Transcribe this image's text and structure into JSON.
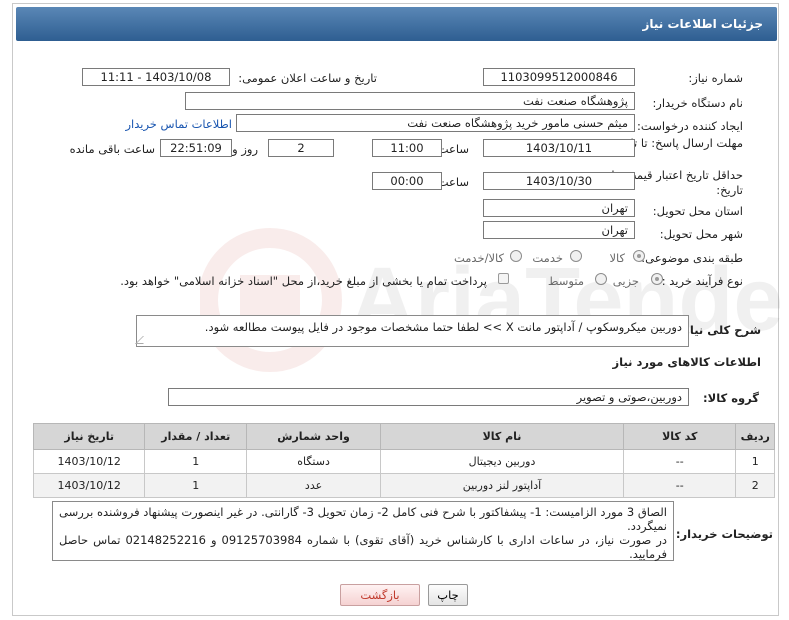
{
  "title": "جزئیات اطلاعات نیاز",
  "fields": {
    "need_number_label": "شماره نیاز:",
    "need_number": "1103099512000846",
    "announce_label": "تاریخ و ساعت اعلان عمومی:",
    "announce_value": "1403/10/08 - 11:11",
    "buyer_label": "نام دستگاه خریدار:",
    "buyer_value": "پژوهشگاه صنعت نفت",
    "creator_label": "ایجاد کننده درخواست:",
    "creator_value": "میثم حسنی مامور خرید پژوهشگاه صنعت نفت",
    "contact_link": "اطلاعات تماس خریدار",
    "deadline_label": "مهلت ارسال پاسخ: تا تاریخ:",
    "deadline_date": "1403/10/11",
    "time_label": "ساعت",
    "deadline_time": "11:00",
    "days_value": "2",
    "days_label": "روز و",
    "remaining_time": "22:51:09",
    "remaining_label": "ساعت باقی مانده",
    "validity_label": "حداقل تاریخ اعتبار قیمت: تا تاریخ:",
    "validity_date": "1403/10/30",
    "validity_time": "00:00",
    "province_label": "استان محل تحویل:",
    "province_value": "تهران",
    "city_label": "شهر محل تحویل:",
    "city_value": "تهران",
    "category_label": "طبقه بندی موضوعی:",
    "category_options": [
      "کالا",
      "خدمت",
      "کالا/خدمت"
    ],
    "process_label": "نوع فرآیند خرید :",
    "process_options": [
      "جزیی",
      "متوسط"
    ],
    "payment_note": "پرداخت تمام یا بخشی از مبلغ خرید،از محل \"اسناد خزانه اسلامی\" خواهد بود.",
    "summary_label": "شرح کلی نیاز:",
    "summary_value": "دوربین میکروسکوپ / آداپتور مانت X >> لطفا حتما مشخصات موجود در فایل پیوست مطالعه شود.",
    "goods_info_title": "اطلاعات کالاهای مورد نیاز",
    "goods_group_label": "گروه کالا:",
    "goods_group_value": "دوربین،صوتی و تصویر"
  },
  "table": {
    "headers": [
      "ردیف",
      "کد کالا",
      "نام کالا",
      "واحد شمارش",
      "تعداد / مقدار",
      "تاریخ نیاز"
    ],
    "rows": [
      [
        "1",
        "--",
        "دوربین دیجیتال",
        "دستگاه",
        "1",
        "1403/10/12"
      ],
      [
        "2",
        "--",
        "آداپتور لنز دوربین",
        "عدد",
        "1",
        "1403/10/12"
      ]
    ]
  },
  "notes": {
    "label": "توضیحات خریدار:",
    "line1": "الصاق 3 مورد الزامیست: 1- پیشفاکتور با شرح فنی کامل 2- زمان تحویل 3- گارانتی. در غیر اینصورت پیشنهاد فروشنده بررسی نمیگردد.",
    "line2": "در صورت نیاز، در ساعات اداری با کارشناس خرید (آقای تقوی)  با شماره 09125703984 و 02148252216 تماس حاصل فرمایید."
  },
  "buttons": {
    "print": "چاپ",
    "back": "بازگشت"
  },
  "colors": {
    "title_bar": "#2e5e91",
    "link": "#1a56b0",
    "back_button_text": "#c0392b"
  }
}
